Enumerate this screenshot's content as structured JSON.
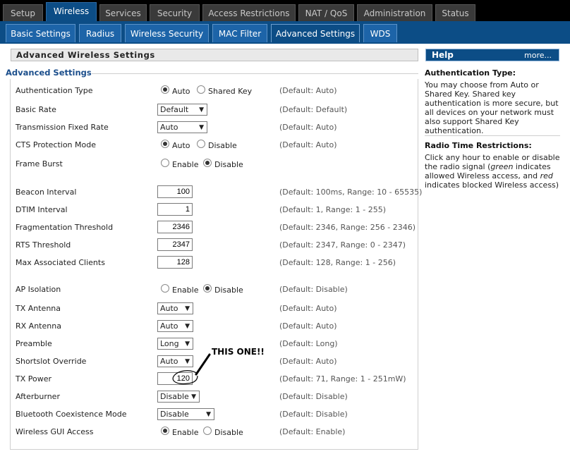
{
  "top_tabs": [
    {
      "label": "Setup"
    },
    {
      "label": "Wireless"
    },
    {
      "label": "Services"
    },
    {
      "label": "Security"
    },
    {
      "label": "Access Restrictions"
    },
    {
      "label": "NAT / QoS"
    },
    {
      "label": "Administration"
    },
    {
      "label": "Status"
    }
  ],
  "sub_tabs": [
    {
      "label": "Basic Settings"
    },
    {
      "label": "Radius"
    },
    {
      "label": "Wireless Security"
    },
    {
      "label": "MAC Filter"
    },
    {
      "label": "Advanced Settings"
    },
    {
      "label": "WDS"
    }
  ],
  "page_heading": "Advanced Wireless Settings",
  "section_legend": "Advanced Settings",
  "settings": {
    "auth_type": {
      "label": "Authentication Type",
      "opt1": "Auto",
      "opt2": "Shared Key",
      "default": "(Default: Auto)"
    },
    "basic_rate": {
      "label": "Basic Rate",
      "value": "Default",
      "default": "(Default: Default)"
    },
    "tx_fixed_rate": {
      "label": "Transmission Fixed Rate",
      "value": "Auto",
      "default": "(Default: Auto)"
    },
    "cts": {
      "label": "CTS Protection Mode",
      "opt1": "Auto",
      "opt2": "Disable",
      "default": "(Default: Auto)"
    },
    "frame_burst": {
      "label": "Frame Burst",
      "opt1": "Enable",
      "opt2": "Disable"
    },
    "beacon": {
      "label": "Beacon Interval",
      "value": "100",
      "default": "(Default: 100ms, Range: 10 - 65535)"
    },
    "dtim": {
      "label": "DTIM Interval",
      "value": "1",
      "default": "(Default: 1, Range: 1 - 255)"
    },
    "frag": {
      "label": "Fragmentation Threshold",
      "value": "2346",
      "default": "(Default: 2346, Range: 256 - 2346)"
    },
    "rts": {
      "label": "RTS Threshold",
      "value": "2347",
      "default": "(Default: 2347, Range: 0 - 2347)"
    },
    "max_clients": {
      "label": "Max Associated Clients",
      "value": "128",
      "default": "(Default: 128, Range: 1 - 256)"
    },
    "ap_isolation": {
      "label": "AP Isolation",
      "opt1": "Enable",
      "opt2": "Disable",
      "default": "(Default: Disable)"
    },
    "tx_antenna": {
      "label": "TX Antenna",
      "value": "Auto",
      "default": "(Default: Auto)"
    },
    "rx_antenna": {
      "label": "RX Antenna",
      "value": "Auto",
      "default": "(Default: Auto)"
    },
    "preamble": {
      "label": "Preamble",
      "value": "Long",
      "default": "(Default: Long)"
    },
    "shortslot": {
      "label": "Shortslot Override",
      "value": "Auto",
      "default": "(Default: Auto)"
    },
    "tx_power": {
      "label": "TX Power",
      "value": "120",
      "default": "(Default: 71, Range: 1 - 251mW)"
    },
    "afterburner": {
      "label": "Afterburner",
      "value": "Disable",
      "default": "(Default: Disable)"
    },
    "bt_coex": {
      "label": "Bluetooth Coexistence Mode",
      "value": "Disable",
      "default": "(Default: Disable)"
    },
    "gui_access": {
      "label": "Wireless GUI Access",
      "opt1": "Enable",
      "opt2": "Disable",
      "default": "(Default: Enable)"
    }
  },
  "annotation": "THIS ONE!!",
  "help": {
    "title": "Help",
    "more": "more...",
    "auth_title": "Authentication Type:",
    "auth_text": "You may choose from Auto or Shared Key. Shared key authentication is more secure, but all devices on your network must also support Shared Key authentication.",
    "radio_title": "Radio Time Restrictions:",
    "radio_text_1": "Click any hour to enable or disable the radio signal (",
    "radio_green": "green",
    "radio_text_2": " indicates allowed Wireless access, and ",
    "radio_red": "red",
    "radio_text_3": " indicates blocked Wireless access)"
  }
}
